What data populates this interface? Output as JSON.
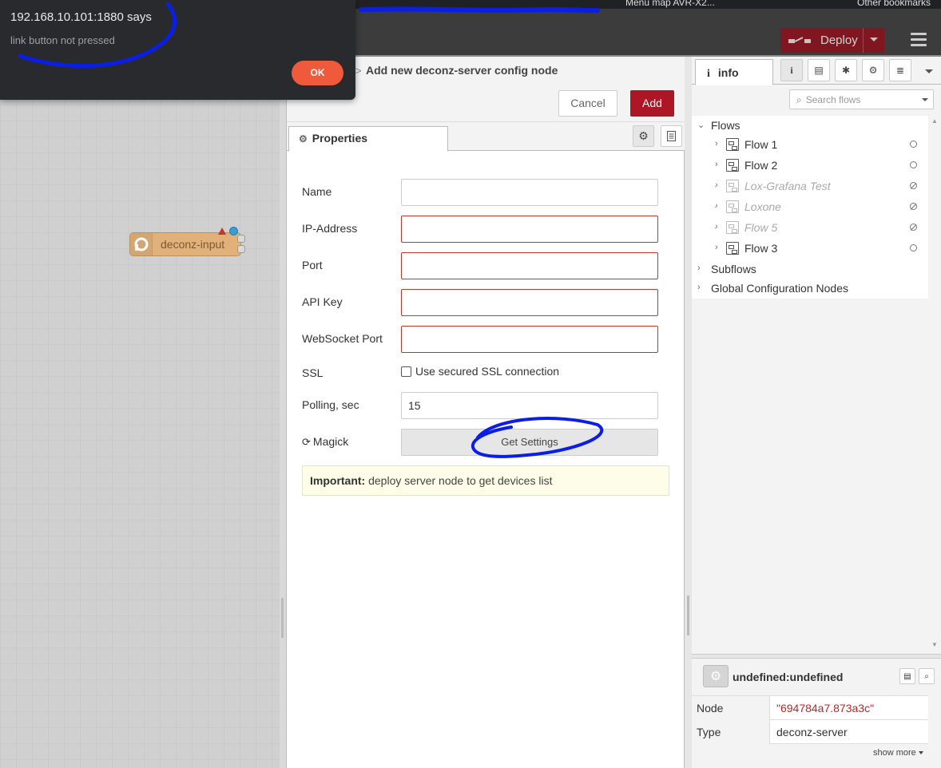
{
  "browser": {
    "bookmarks": [
      {
        "label": "Menu map AVR-X2..."
      },
      {
        "label": "Other bookmarks"
      }
    ]
  },
  "alert": {
    "title": "192.168.10.101:1880 says",
    "message": "link button not pressed",
    "ok_label": "OK"
  },
  "header": {
    "deploy_label": "Deploy"
  },
  "workspace": {
    "node_label": "deconz-input"
  },
  "tray": {
    "breadcrumb_sep": ">",
    "title": "Add new deconz-server config node",
    "cancel_label": "Cancel",
    "add_label": "Add",
    "tab_label": "Properties",
    "fields": {
      "name_label": "Name",
      "name_value": "",
      "ip_label": "IP-Address",
      "ip_value": "",
      "port_label": "Port",
      "port_value": "",
      "apikey_label": "API Key",
      "apikey_value": "",
      "wsport_label": "WebSocket Port",
      "wsport_value": "",
      "ssl_label": "SSL",
      "ssl_checkbox_label": "Use secured SSL connection",
      "polling_label": "Polling, sec",
      "polling_value": "15",
      "magick_label": "Magick",
      "get_settings_label": "Get Settings"
    },
    "tip_bold": "Important:",
    "tip_text": "deploy server node to get devices list"
  },
  "sidebar": {
    "tab_label": "info",
    "search_placeholder": "Search flows",
    "tree": {
      "flows_label": "Flows",
      "flows": [
        {
          "label": "Flow 1",
          "disabled": false
        },
        {
          "label": "Flow 2",
          "disabled": false
        },
        {
          "label": "Lox-Grafana Test",
          "disabled": true
        },
        {
          "label": "Loxone",
          "disabled": true
        },
        {
          "label": "Flow 5",
          "disabled": true
        },
        {
          "label": "Flow 3",
          "disabled": false
        }
      ],
      "subflows_label": "Subflows",
      "global_config_label": "Global Configuration Nodes"
    },
    "node_panel": {
      "title": "undefined:undefined",
      "rows": [
        {
          "key": "Node",
          "value": "\"694784a7.873a3c\""
        },
        {
          "key": "Type",
          "value": "deconz-server"
        }
      ],
      "show_more": "show more"
    }
  },
  "colors": {
    "deploy": "#8c101c",
    "add_button": "#ad1625",
    "alert_ok": "#f05a3c",
    "invalid_border": "#c0392b",
    "marker": "#0a1ee6"
  }
}
